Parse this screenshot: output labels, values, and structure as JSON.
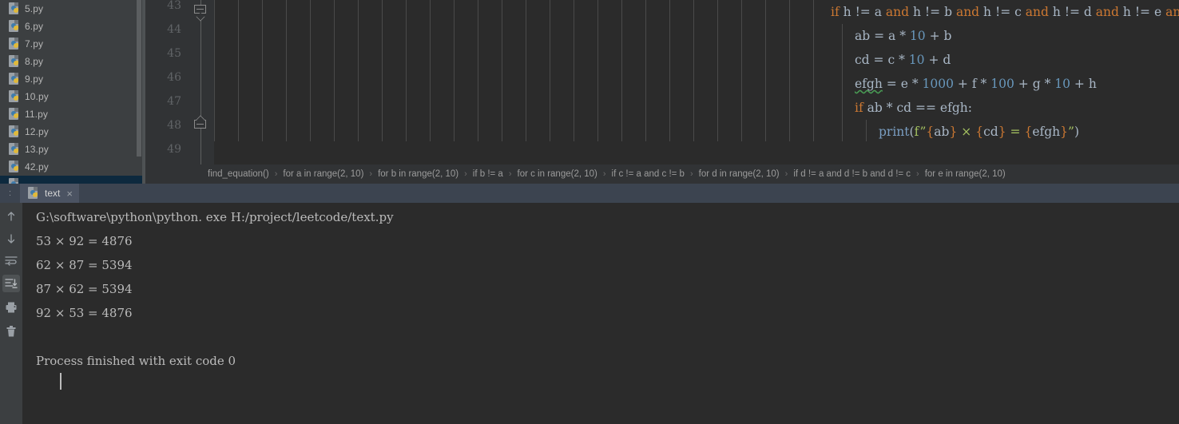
{
  "project_files": {
    "items": [
      {
        "name": "5.py",
        "selected": false
      },
      {
        "name": "6.py",
        "selected": false
      },
      {
        "name": "7.py",
        "selected": false
      },
      {
        "name": "8.py",
        "selected": false
      },
      {
        "name": "9.py",
        "selected": false
      },
      {
        "name": "10.py",
        "selected": false
      },
      {
        "name": "11.py",
        "selected": false
      },
      {
        "name": "12.py",
        "selected": false
      },
      {
        "name": "13.py",
        "selected": false
      },
      {
        "name": "42.py",
        "selected": false
      },
      {
        "name": "",
        "selected": true
      }
    ]
  },
  "editor": {
    "line_numbers": [
      "43",
      "44",
      "45",
      "46",
      "47",
      "48",
      "49"
    ],
    "lines": [
      {
        "n": "43",
        "text": "if h != a and h != b and h != c and h != d and h != e and h"
      },
      {
        "n": "44",
        "text": "    ab = a * 10 + b"
      },
      {
        "n": "45",
        "text": "    cd = c * 10 + d"
      },
      {
        "n": "46",
        "text": "    efgh = e * 1000 + f * 100 + g * 10 + h"
      },
      {
        "n": "47",
        "text": "    if ab * cd == efgh:"
      },
      {
        "n": "48",
        "text": "        print(f\"{ab} × {cd} = {efgh}\")"
      }
    ],
    "tokens": {
      "kw_if": "if",
      "kw_and": "and",
      "identifier_h": "h",
      "neq": "!=",
      "var_a": "a",
      "var_b": "b",
      "var_c": "c",
      "var_d": "d",
      "var_e": "e",
      "var_f": "f",
      "var_g": "g",
      "var_ab": "ab",
      "var_cd": "cd",
      "var_efgh": "efgh",
      "num_10": "10",
      "num_100": "100",
      "num_1000": "1000",
      "fn_print": "print",
      "op_eq": "=",
      "op_eqeq": "==",
      "op_mul": "*",
      "op_plus": "+",
      "colon": ":",
      "times_symbol": "×",
      "fstr_prefix": "f",
      "quote": "\"",
      "brace_open": "{",
      "brace_close": "}",
      "paren_open": "(",
      "paren_close": ")"
    }
  },
  "breadcrumb": {
    "separator": "›",
    "items": [
      "find_equation()",
      "for a in range(2, 10)",
      "for b in range(2, 10)",
      "if b != a",
      "for c in range(2, 10)",
      "if c != a and c != b",
      "for d in range(2, 10)",
      "if d != a and d != b and d != c",
      "for e in range(2, 10)"
    ]
  },
  "tabbar": {
    "gutter_glyph": ":",
    "tab_label": "text",
    "close_glyph": "×"
  },
  "console_toolbar": {
    "buttons": [
      {
        "name": "up-arrow-icon",
        "active": false
      },
      {
        "name": "down-arrow-icon",
        "active": false
      },
      {
        "name": "soft-wrap-icon",
        "active": false
      },
      {
        "name": "scroll-to-end-icon",
        "active": true
      },
      {
        "name": "print-icon",
        "active": false
      },
      {
        "name": "trash-icon",
        "active": false
      }
    ]
  },
  "console": {
    "lines": [
      "G:\\software\\python\\python. exe H:/project/leetcode/text.py",
      "53 × 92 = 4876",
      "62 × 87 = 5394",
      "87 × 62 = 5394",
      "92 × 53 = 4876",
      "",
      "Process finished with exit code 0"
    ]
  },
  "colors": {
    "editor_bg": "#2b2b2b",
    "gutter_bg": "#313335",
    "panel_bg": "#3c3f41",
    "tabbar_bg": "#3c4450",
    "tab_active_bg": "#4b5362",
    "selection_blue": "#0d293e",
    "keyword_orange": "#cc7832",
    "number_blue": "#6897bb",
    "text_gray": "#a9b7c6",
    "string_green": "#a5c261",
    "typo_underline": "#499c54"
  }
}
